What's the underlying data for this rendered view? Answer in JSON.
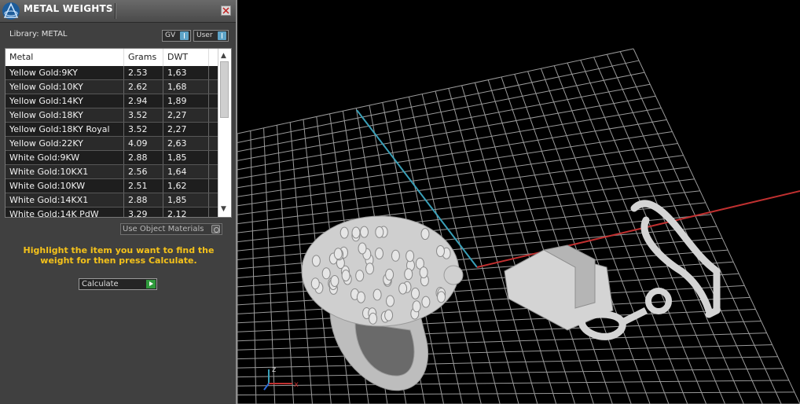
{
  "panel": {
    "title": "METAL WEIGHTS",
    "library_label": "Library: METAL",
    "toggles": {
      "gv": "GV",
      "user": "User"
    },
    "table": {
      "columns": [
        "Metal",
        "Grams",
        "DWT"
      ],
      "rows": [
        [
          "Yellow Gold:9KY",
          "2.53",
          "1,63"
        ],
        [
          "Yellow Gold:10KY",
          "2.62",
          "1,68"
        ],
        [
          "Yellow Gold:14KY",
          "2.94",
          "1,89"
        ],
        [
          "Yellow Gold:18KY",
          "3.52",
          "2,27"
        ],
        [
          "Yellow Gold:18KY Royal",
          "3.52",
          "2,27"
        ],
        [
          "Yellow Gold:22KY",
          "4.09",
          "2,63"
        ],
        [
          "White Gold:9KW",
          "2.88",
          "1,85"
        ],
        [
          "White Gold:10KX1",
          "2.56",
          "1,64"
        ],
        [
          "White Gold:10KW",
          "2.51",
          "1,62"
        ],
        [
          "White Gold:14KX1",
          "2.88",
          "1,85"
        ],
        [
          "White Gold:14K PdW",
          "3.29",
          "2,12"
        ]
      ]
    },
    "use_object_materials": "Use Object Materials",
    "hint": "Highlight the item you want to find the weight for then press Calculate.",
    "calculate_label": "Calculate"
  },
  "viewport": {
    "axis_labels": {
      "z": "z",
      "x": "x"
    },
    "colors": {
      "grid": "#9a9a9a",
      "x_axis": "#c03030",
      "y_axis": "#3aa0b8",
      "model": "#d8d8d8"
    }
  }
}
